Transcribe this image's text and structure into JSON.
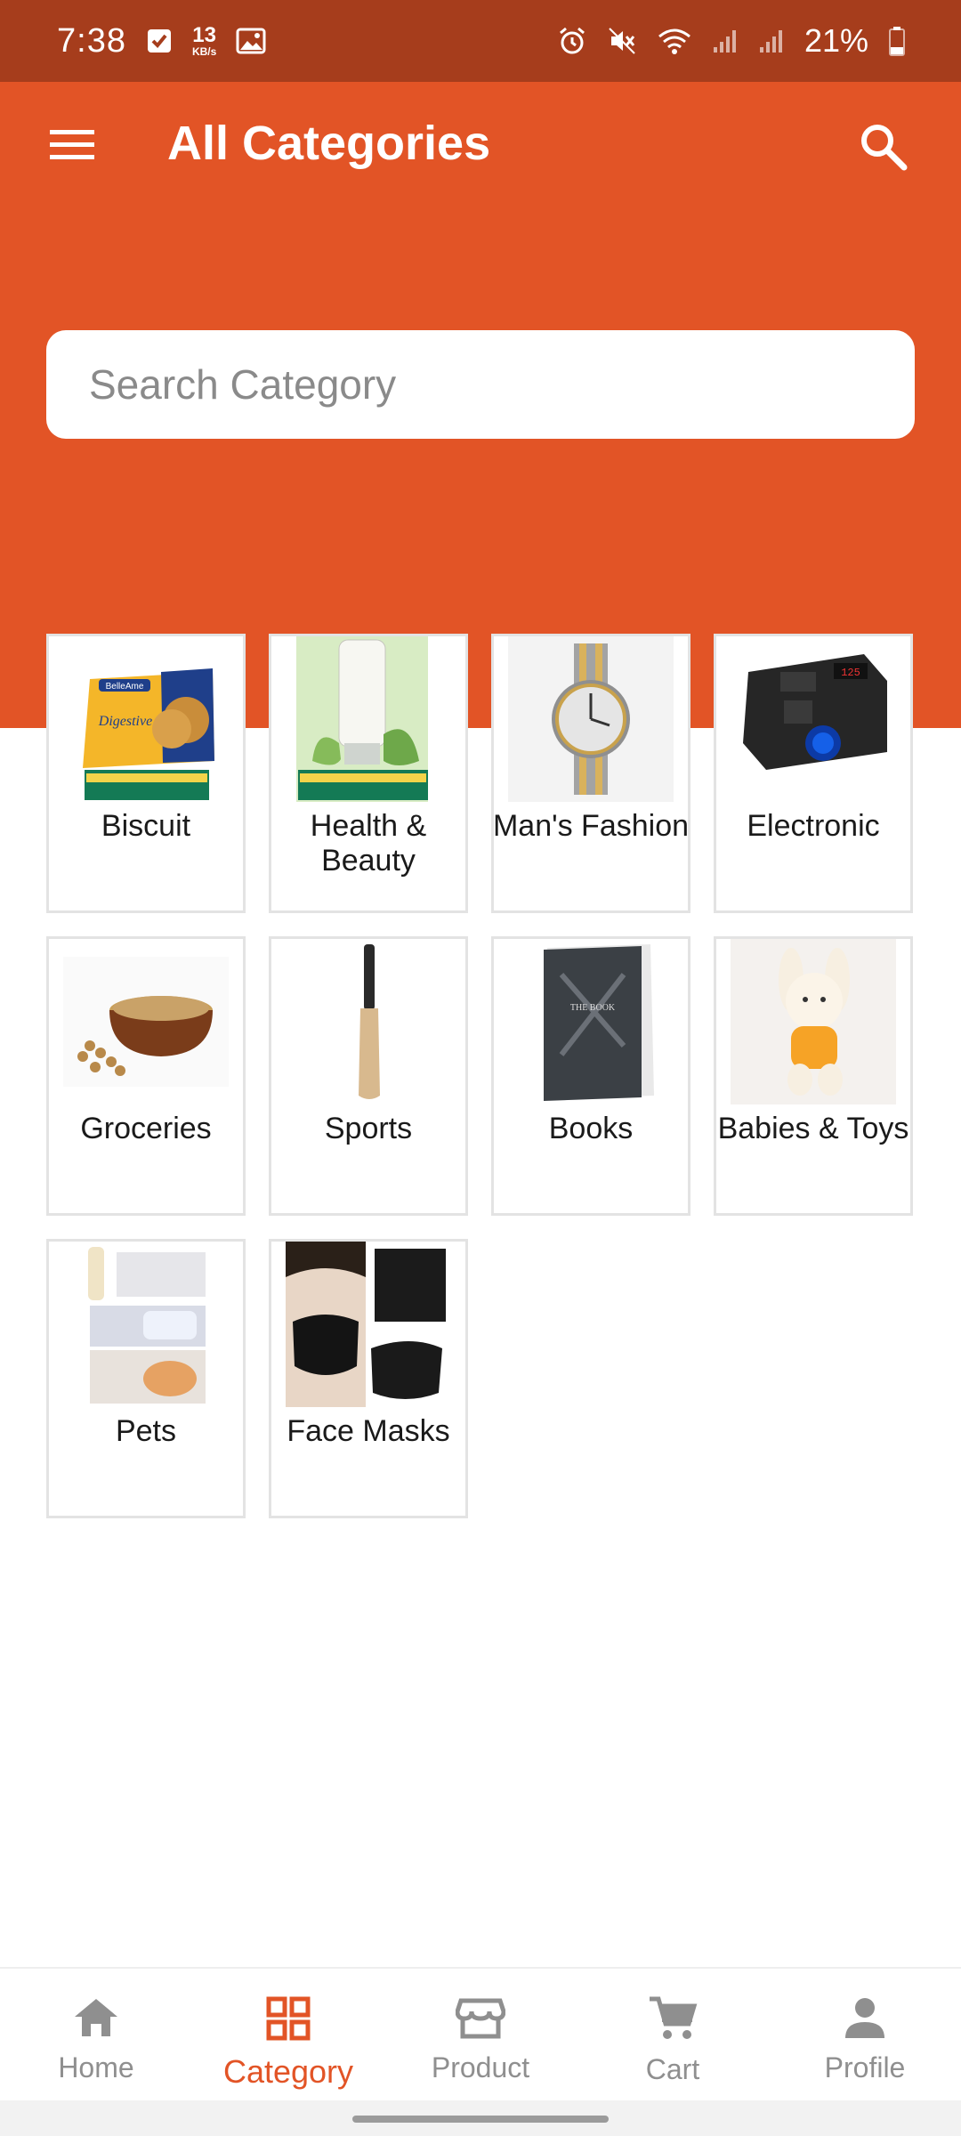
{
  "status_bar": {
    "time": "7:38",
    "net_speed_value": "13",
    "net_speed_unit": "KB/s",
    "battery": "21%"
  },
  "app_bar": {
    "title": "All Categories",
    "menu_icon": "hamburger-menu-icon",
    "search_icon": "search-icon"
  },
  "search": {
    "placeholder": "Search Category",
    "value": ""
  },
  "categories": [
    {
      "label": "Biscuit",
      "icon": "biscuit-image"
    },
    {
      "label": "Health & Beauty",
      "icon": "face-wash-image"
    },
    {
      "label": "Man's Fashion",
      "icon": "wristwatch-image"
    },
    {
      "label": "Electronic",
      "icon": "power-adapter-image"
    },
    {
      "label": "Groceries",
      "icon": "spice-bowl-image"
    },
    {
      "label": "Sports",
      "icon": "cricket-bat-image"
    },
    {
      "label": "Books",
      "icon": "book-image"
    },
    {
      "label": "Babies & Toys",
      "icon": "plush-bunny-image"
    },
    {
      "label": "Pets",
      "icon": "pet-feeding-bottle-image"
    },
    {
      "label": "Face Masks",
      "icon": "black-face-mask-image"
    }
  ],
  "bottom_nav": [
    {
      "label": "Home",
      "icon": "home-icon",
      "active": false
    },
    {
      "label": "Category",
      "icon": "grid-icon",
      "active": true
    },
    {
      "label": "Product",
      "icon": "store-icon",
      "active": false
    },
    {
      "label": "Cart",
      "icon": "cart-icon",
      "active": false
    },
    {
      "label": "Profile",
      "icon": "person-icon",
      "active": false
    }
  ],
  "colors": {
    "primary": "#e25426",
    "status_bar": "#a63d1c",
    "nav_inactive": "#8f8f8f"
  }
}
